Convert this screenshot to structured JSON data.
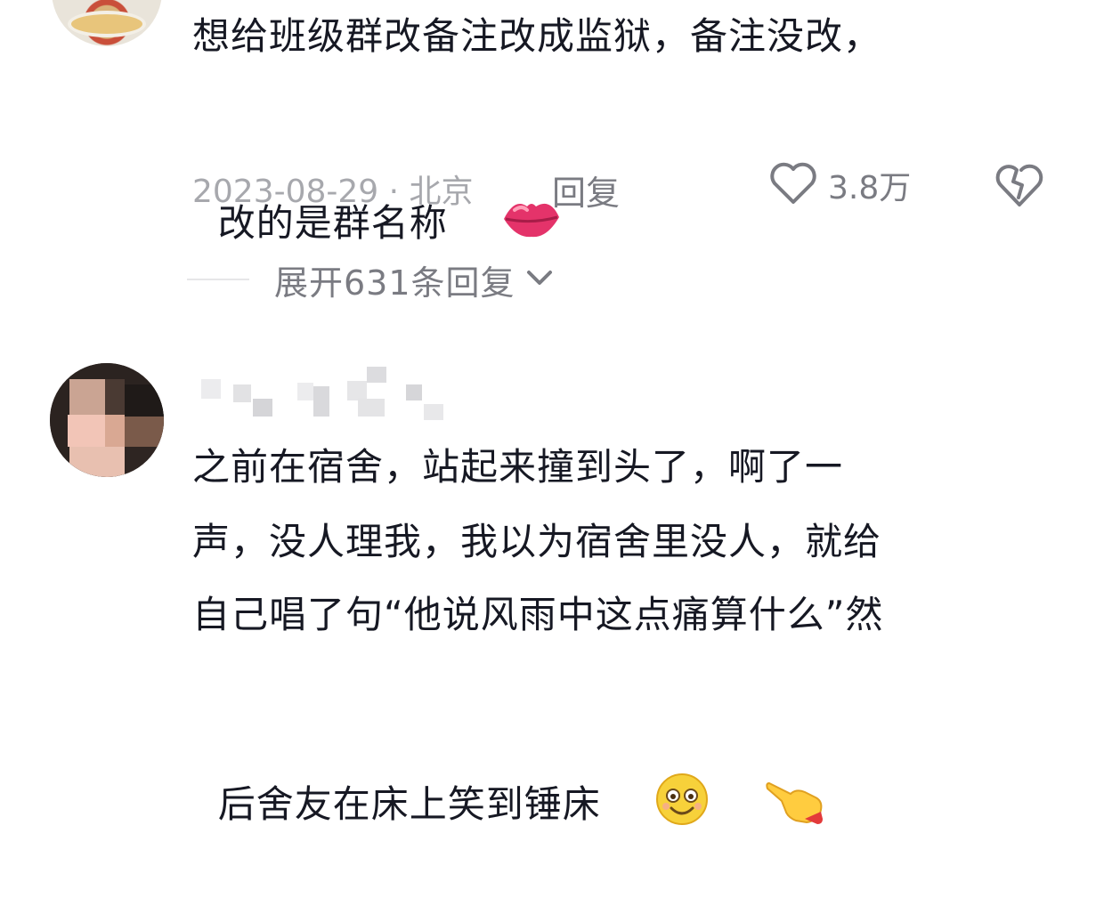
{
  "comment1": {
    "text_lines": [
      "想给班级群改备注改成监狱，备注没改，",
      "改的是群名称"
    ],
    "emoji": "lips-emoji",
    "date_location": "2023-08-29 · 北京",
    "reply_label": "回复",
    "like_count": "3.8万",
    "expand_replies": "展开631条回复"
  },
  "comment2": {
    "username_visible": false,
    "text_lines": [
      "之前在宿舍，站起来撞到头了，啊了一",
      "声，没人理我，我以为宿舍里没人，就给",
      "自己唱了句“他说风雨中这点痛算什么”然",
      "后舍友在床上笑到锤床"
    ],
    "emojis": [
      "smiling-face-emoji",
      "pointing-hand-emoji"
    ]
  },
  "colors": {
    "primary_text": "#161823",
    "secondary_text": "#7a7b82",
    "meta_text": "#a7a8ad",
    "divider": "#e6e6e8",
    "background": "#ffffff"
  }
}
